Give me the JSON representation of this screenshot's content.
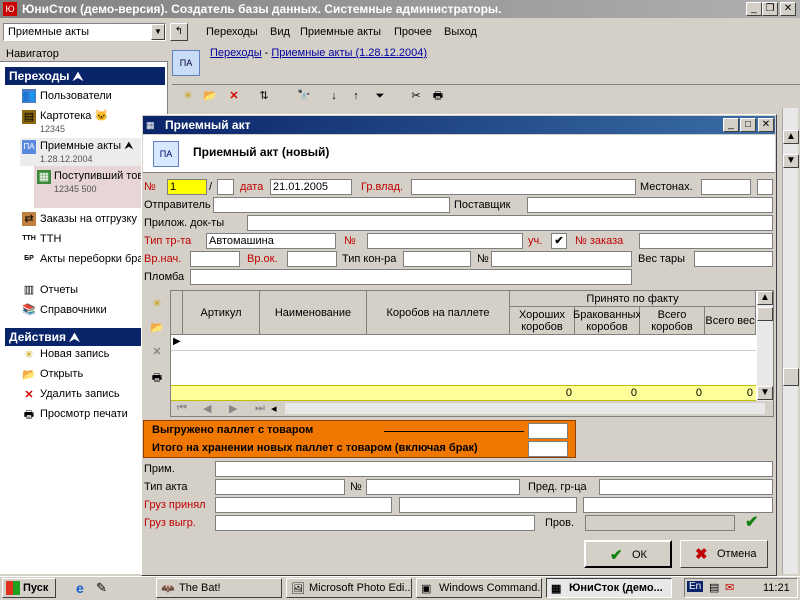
{
  "app": {
    "title": "ЮниСток (демо-версия). Создатель базы данных. Системные администраторы."
  },
  "toolbar": {
    "combo_value": "Приемные акты",
    "menu": [
      "Переходы",
      "Вид",
      "Приемные акты",
      "Прочее",
      "Выход"
    ]
  },
  "breadcrumb": {
    "root": "Переходы",
    "sep": " - ",
    "current": "Приемные акты (1.28.12.2004)"
  },
  "navigator": {
    "title": "Навигатор",
    "section1": "Переходы",
    "items": [
      {
        "label": "Пользователи",
        "sub": ""
      },
      {
        "label": "Картотека",
        "sub": "12345"
      },
      {
        "label": "Приемные акты",
        "sub": "1.28.12.2004"
      },
      {
        "label": "Поступивший товар",
        "sub": "12345 500"
      },
      {
        "label": "Заказы на отгрузку",
        "sub": ""
      },
      {
        "label": "ТТН",
        "sub": ""
      },
      {
        "label": "Акты переборки брака",
        "sub": ""
      },
      {
        "label": "Отчеты",
        "sub": ""
      },
      {
        "label": "Справочники",
        "sub": ""
      }
    ],
    "section2": "Действия",
    "actions": [
      "Новая запись",
      "Открыть",
      "Удалить запись",
      "Просмотр печати"
    ]
  },
  "dialog": {
    "title": "Приемный акт",
    "header": "Приемный акт (новый)",
    "logo": "ПА",
    "fields": {
      "num_label": "№",
      "num_value": "1",
      "slash": "/",
      "date_label": "дата",
      "date_value": "21.01.2005",
      "grvlad_label": "Гр.влад.",
      "mestonah_label": "Местонах.",
      "sender_label": "Отправитель",
      "supplier_label": "Поставщик",
      "docs_label": "Прилож. док-ты",
      "transport_label": "Тип тр-та",
      "transport_value": "Автомашина",
      "tnum_label": "№",
      "uch_label": "уч.",
      "order_label": "№ заказа",
      "start_label": "Вр.нач.",
      "end_label": "Вр.ок.",
      "container_label": "Тип кон-ра",
      "cnum_label": "№",
      "tare_label": "Вес тары",
      "seal_label": "Пломба"
    },
    "grid": {
      "columns": [
        "Артикул",
        "Наименование",
        "Коробов на паллете"
      ],
      "group": "Принято по факту",
      "subcolumns": [
        "Хороших коробов",
        "Бракованных коробов",
        "Всего коробов",
        "Всего вес"
      ],
      "totals": [
        "0",
        "0",
        "0",
        "0"
      ]
    },
    "summary": {
      "line1": "Выгружено паллет с товаром",
      "line2": "Итого на хранении новых паллет с товаром (включая брак)"
    },
    "bottom": {
      "prim_label": "Прим.",
      "akt_label": "Тип акта",
      "anum_label": "№",
      "pred_label": "Пред. гр-ца",
      "gruz_prin_label": "Груз принял",
      "gruz_vygr_label": "Груз выгр.",
      "prov_label": "Пров."
    },
    "ok": "ОК",
    "cancel": "Отмена"
  },
  "taskbar": {
    "start": "Пуск",
    "tasks": [
      "The Bat!",
      "Microsoft Photo Edi...",
      "Windows Command...",
      "ЮниСток (демо..."
    ],
    "lang": "En",
    "clock": "11:21"
  },
  "colors": {
    "titlebar": "#0a246a",
    "active_field": "#ffff00",
    "summary": "#f07800",
    "total_row": "#ffff99"
  }
}
